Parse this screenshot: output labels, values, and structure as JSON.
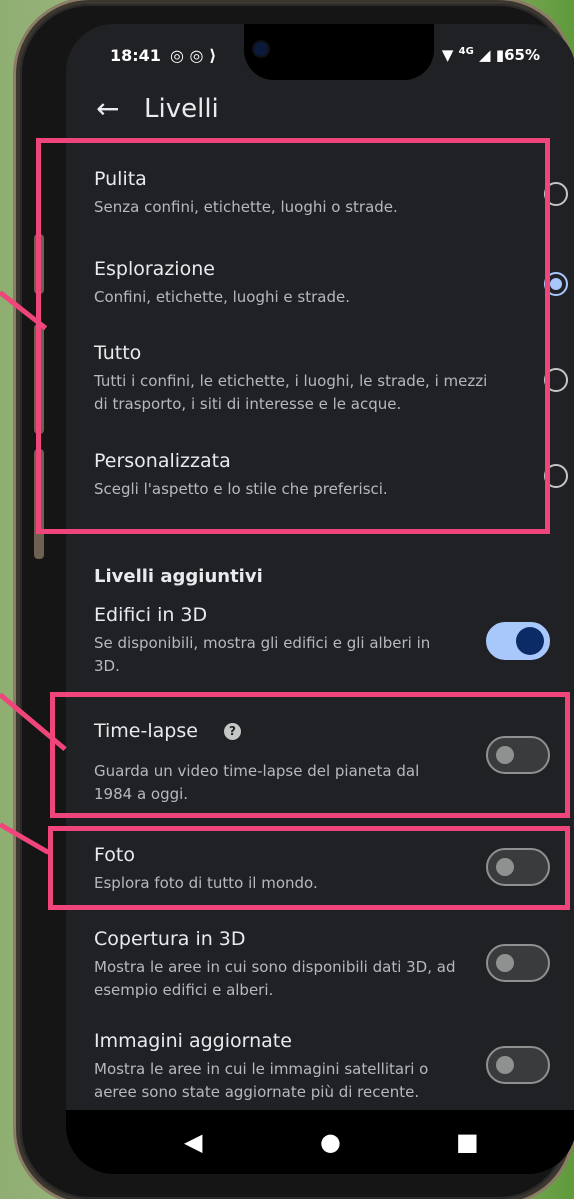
{
  "status_bar": {
    "time": "18:41",
    "left_icons": "◎ ◎ ⟩",
    "network": "4G",
    "battery": "65%"
  },
  "app_bar": {
    "title": "Livelli"
  },
  "map_types": [
    {
      "title": "Pulita",
      "subtitle": "Senza confini, etichette, luoghi o strade.",
      "selected": false
    },
    {
      "title": "Esplorazione",
      "subtitle": "Confini, etichette, luoghi e strade.",
      "selected": true
    },
    {
      "title": "Tutto",
      "subtitle": "Tutti i confini, le etichette, i luoghi, le strade, i mezzi di trasporto, i siti di interesse e le acque.",
      "selected": false
    },
    {
      "title": "Personalizzata",
      "subtitle": "Scegli l'aspetto e lo stile che preferisci.",
      "selected": false
    }
  ],
  "additional_layers": {
    "heading": "Livelli aggiuntivi",
    "items": [
      {
        "title": "Edifici in 3D",
        "subtitle": "Se disponibili, mostra gli edifici e gli alberi in 3D.",
        "enabled": true
      },
      {
        "title": "Time-lapse",
        "subtitle": "Guarda un video time-lapse del pianeta dal 1984 a oggi.",
        "enabled": false,
        "help_icon": "?"
      },
      {
        "title": "Foto",
        "subtitle": "Esplora foto di tutto il mondo.",
        "enabled": false
      },
      {
        "title": "Copertura in 3D",
        "subtitle": "Mostra le aree in cui sono disponibili dati 3D, ad esempio edifici e alberi.",
        "enabled": false
      },
      {
        "title": "Immagini aggiornate",
        "subtitle": "Mostra le aree in cui le immagini satellitari o aeree sono state aggiornate più di recente.",
        "enabled": false
      }
    ]
  },
  "nav_bar": {
    "back": "◀",
    "home": "●",
    "recents": "■"
  },
  "colors": {
    "highlight": "#f0457a",
    "accent": "#a8c7fa",
    "background": "#202124"
  }
}
